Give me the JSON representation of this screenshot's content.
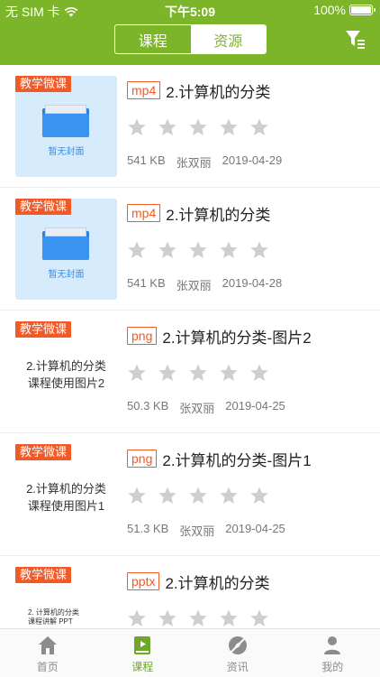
{
  "status_bar": {
    "carrier": "无 SIM 卡",
    "time": "下午5:09",
    "battery": "100%"
  },
  "segment": {
    "tab1": "课程",
    "tab2": "资源"
  },
  "items": [
    {
      "tag": "教学微课",
      "cover_text": "暂无封面",
      "cover_type": "folder",
      "type": "mp4",
      "title": "2.计算机的分类",
      "size": "541 KB",
      "author": "张双丽",
      "date": "2019-04-29",
      "rating": 0
    },
    {
      "tag": "教学微课",
      "cover_text": "暂无封面",
      "cover_type": "folder",
      "type": "mp4",
      "title": "2.计算机的分类",
      "size": "541 KB",
      "author": "张双丽",
      "date": "2019-04-28",
      "rating": 0
    },
    {
      "tag": "教学微课",
      "caption_line1": "2.计算机的分类",
      "caption_line2": "课程使用图片2",
      "type": "png",
      "title": "2.计算机的分类-图片2",
      "size": "50.3 KB",
      "author": "张双丽",
      "date": "2019-04-25",
      "rating": 0
    },
    {
      "tag": "教学微课",
      "caption_line1": "2.计算机的分类",
      "caption_line2": "课程使用图片1",
      "type": "png",
      "title": "2.计算机的分类-图片1",
      "size": "51.3 KB",
      "author": "张双丽",
      "date": "2019-04-25",
      "rating": 0
    },
    {
      "tag": "教学微课",
      "caption_line1": "2. 计算机的分类",
      "caption_line2": "课程讲解 PPT",
      "type": "pptx",
      "title": "2.计算机的分类",
      "rating": 0
    }
  ],
  "tabbar": {
    "home": "首页",
    "course": "课程",
    "news": "资讯",
    "mine": "我的"
  },
  "colors": {
    "brand_green": "#7db52a",
    "tag_orange": "#f15a26",
    "star_gray": "#cfcfcf"
  },
  "icons": {
    "filter": "filter-icon",
    "home": "home-icon",
    "course": "book-icon",
    "news": "compass-icon",
    "mine": "person-icon"
  }
}
